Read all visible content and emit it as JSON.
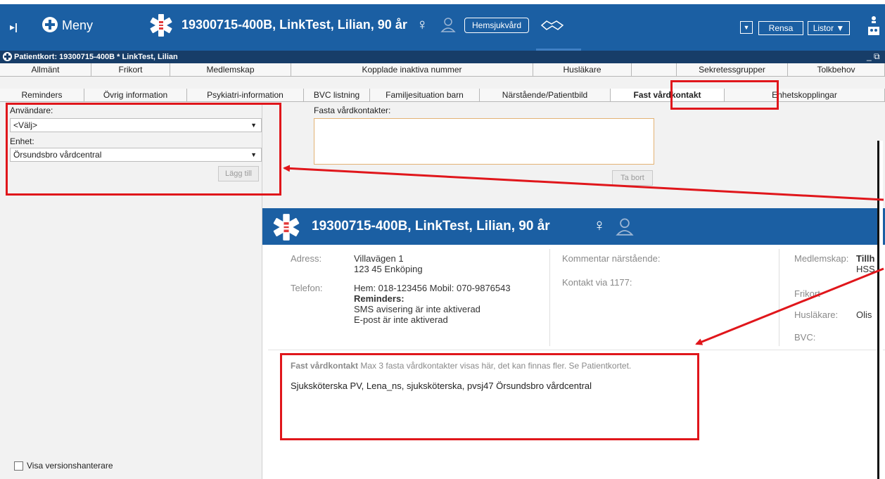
{
  "header": {
    "menu_label": "Meny",
    "patient_title": "19300715-400B, LinkTest, Lilian, 90 år",
    "home_care_button": "Hemsjukvård",
    "clear_button": "Rensa",
    "lists_button": "Listor ▼",
    "dropdown_glyph": "▼",
    "expand_glyph": "▸|",
    "female_glyph": "♀"
  },
  "card_bar": {
    "title": "Patientkort: 19300715-400B * LinkTest, Lilian",
    "window_controls": "_ ⧉ ✕"
  },
  "tabs_row1": [
    "Allmänt",
    "Frikort",
    "Medlemskap",
    "Kopplade inaktiva nummer",
    "Husläkare",
    "",
    "Sekretessgrupper",
    "Tolkbehov"
  ],
  "tabs_row2": [
    "Reminders",
    "Övrig information",
    "Psykiatri-information",
    "BVC listning",
    "Familjesituation barn",
    "Närstående/Patientbild",
    "Fast vårdkontakt",
    "Enhetskopplingar"
  ],
  "form": {
    "user_label": "Användare:",
    "user_value": "<Välj>",
    "unit_label": "Enhet:",
    "unit_value": "Örsundsbro vårdcentral",
    "add_button": "Lägg till",
    "fixed_contacts_label": "Fasta vårdkontakter:",
    "remove_button": "Ta bort",
    "version_checkbox_label": "Visa versionshanterare"
  },
  "inset": {
    "title": "19300715-400B,  LinkTest, Lilian,  90 år",
    "address_label": "Adress:",
    "address_line1": "Villavägen 1",
    "address_line2": "123 45 Enköping",
    "phone_label": "Telefon:",
    "phone_value": "Hem: 018-123456 Mobil: 070-9876543",
    "reminders_heading": "Reminders:",
    "sms_status": "SMS avisering är inte aktiverad",
    "email_status": "E-post är inte aktiverad",
    "relative_comment_label": "Kommentar närstående:",
    "contact_1177_label": "Kontakt via 1177:",
    "membership_label": "Medlemskap:",
    "membership_value_1": "Tillh",
    "membership_value_2": "HSS",
    "frikort_label": "Frikort",
    "gp_label": "Husläkare:",
    "gp_value": "Olis",
    "bvc_label": "BVC:",
    "fast_heading": "Fast vårdkontakt",
    "fast_note": "Max 3 fasta vårdkontakter visas här, det kan finnas fler. Se Patientkortet.",
    "fast_entry": "Sjuksköterska PV, Lena_ns, sjuksköterska, pvsj47 Örsundsbro vårdcentral"
  },
  "colors": {
    "header_blue": "#1b5fa3",
    "card_bar_navy": "#173d68",
    "highlight_red": "#e0161b",
    "brand_red": "#e23b3b"
  }
}
